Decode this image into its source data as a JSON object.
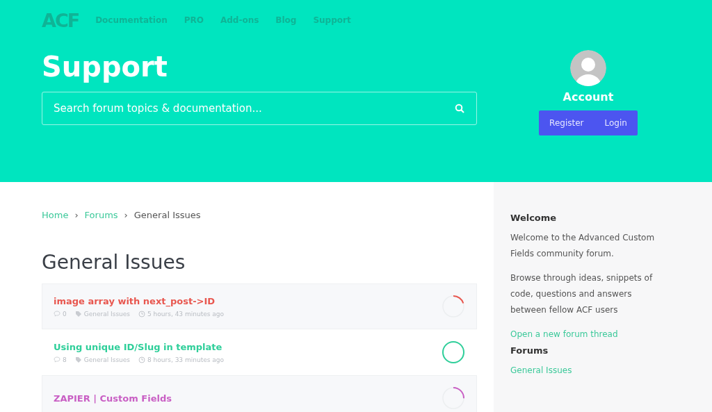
{
  "logo": "ACF",
  "nav": [
    "Documentation",
    "PRO",
    "Add-ons",
    "Blog",
    "Support"
  ],
  "hero": {
    "title": "Support",
    "search": {
      "placeholder": "Search forum topics & documentation..."
    }
  },
  "account": {
    "title": "Account",
    "buttons": [
      "Register",
      "Login"
    ]
  },
  "breadcrumb": {
    "separator": "›",
    "links": [
      "Home",
      "Forums"
    ],
    "current": "General Issues"
  },
  "page_title": "General Issues",
  "topics": [
    {
      "title": "image array with next_post->ID",
      "color": "#e8574f",
      "replies": "0",
      "forum": "General Issues",
      "time": "5 hours, 43 minutes ago"
    },
    {
      "title": "Using unique ID/Slug in template",
      "color": "#2fcf9a",
      "replies": "8",
      "forum": "General Issues",
      "time": "8 hours, 33 minutes ago"
    },
    {
      "title": "ZAPIER | Custom Fields",
      "color": "#c95fc4"
    }
  ],
  "sidebar": {
    "welcome_title": "Welcome",
    "paragraphs": [
      "Welcome to the Advanced Custom Fields community forum.",
      "Browse through ideas, snippets of code, questions and answers between fellow ACF users"
    ],
    "new_thread": "Open a new forum thread",
    "forums_title": "Forums",
    "forums": [
      "General Issues"
    ]
  }
}
